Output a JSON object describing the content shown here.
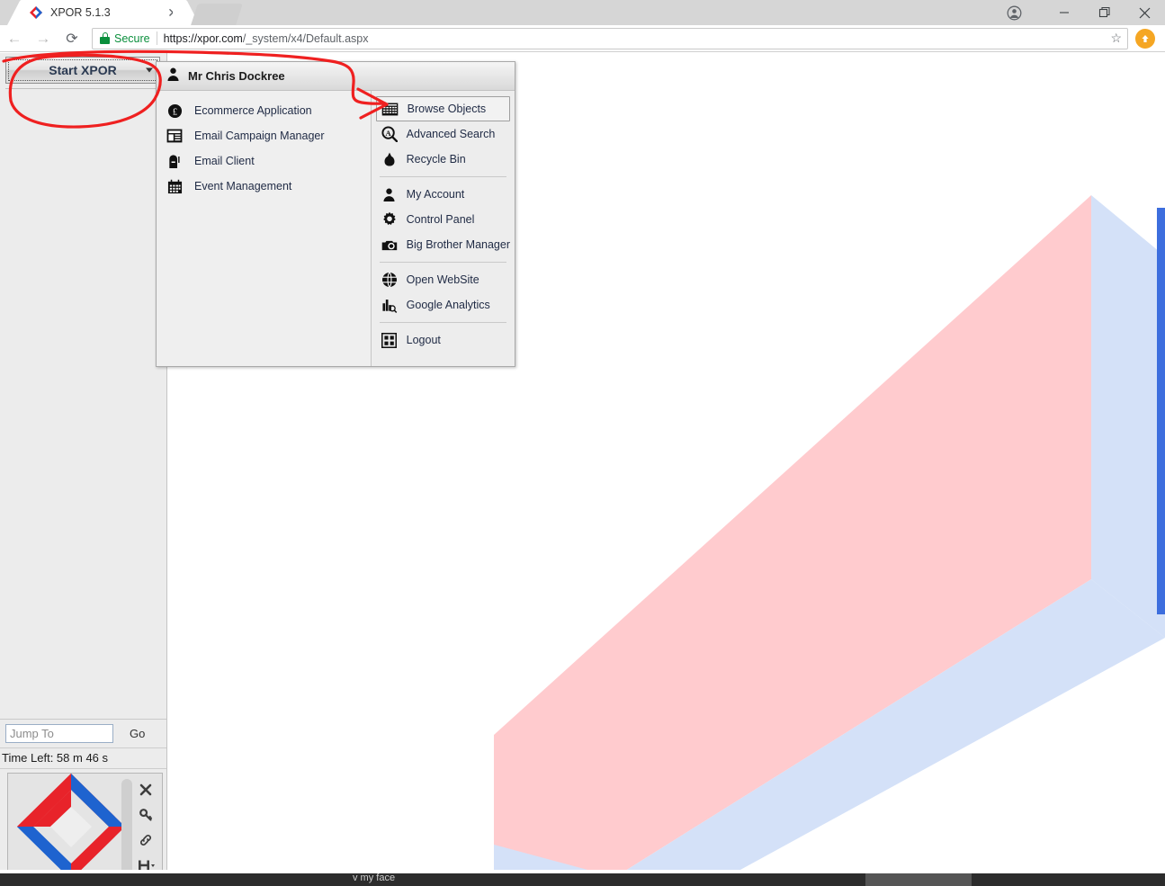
{
  "browser": {
    "tab": {
      "title": "XPOR 5.1.3",
      "favicon": "xpor-diamond-icon",
      "close": "✕"
    },
    "new_tab_tooltip": "New Tab",
    "window_controls": {
      "profile": "profile-icon",
      "minimize": "─",
      "maximize": "❐",
      "close": "✕"
    },
    "nav": {
      "back": "←",
      "forward": "→",
      "reload": "⟳"
    },
    "omnibox": {
      "security_label": "Secure",
      "url_host": "https://xpor.com",
      "url_path": "/_system/x4/Default.aspx",
      "bookmark": "☆"
    },
    "extension": {
      "name": "lastpass-extension-icon"
    }
  },
  "sidebar": {
    "start_button": {
      "label": "Start XPOR",
      "has_dropdown": true
    },
    "jump": {
      "placeholder": "Jump To",
      "value": "",
      "go_label": "Go"
    },
    "time_left": "Time Left: 58 m 46 s",
    "lastpass_widget": {
      "tools": [
        {
          "name": "close-icon",
          "glyph": "✖"
        },
        {
          "name": "key-icon",
          "glyph": "key"
        },
        {
          "name": "link-icon",
          "glyph": "link"
        },
        {
          "name": "save-icon",
          "glyph": "save"
        }
      ]
    }
  },
  "start_menu": {
    "user": "Mr Chris Dockree",
    "user_icon": "person-icon",
    "left_items": [
      {
        "label": "Ecommerce Application",
        "icon": "pound-coin-icon"
      },
      {
        "label": "Email Campaign Manager",
        "icon": "newsletter-icon"
      },
      {
        "label": "Email Client",
        "icon": "mailbox-icon"
      },
      {
        "label": "Event Management",
        "icon": "calendar-icon"
      }
    ],
    "right_groups": [
      {
        "items": [
          {
            "label": "Browse Objects",
            "icon": "grid-table-icon",
            "selected": true
          },
          {
            "label": "Advanced Search",
            "icon": "search-magnifier-icon",
            "selected": false
          },
          {
            "label": "Recycle Bin",
            "icon": "trash-bag-icon",
            "selected": false
          }
        ]
      },
      {
        "items": [
          {
            "label": "My Account",
            "icon": "person-icon",
            "selected": false
          },
          {
            "label": "Control Panel",
            "icon": "gear-icon",
            "selected": false
          },
          {
            "label": "Big Brother Manager",
            "icon": "camera-icon",
            "selected": false
          }
        ]
      },
      {
        "items": [
          {
            "label": "Open WebSite",
            "icon": "globe-icon",
            "selected": false
          },
          {
            "label": "Google Analytics",
            "icon": "bar-chart-magnifier-icon",
            "selected": false
          }
        ]
      },
      {
        "items": [
          {
            "label": "Logout",
            "icon": "windows-grid-icon",
            "selected": false
          }
        ]
      }
    ]
  },
  "annotations": {
    "color": "#ef2020",
    "shapes": [
      {
        "name": "ellipse-around-start-button",
        "type": "ellipse"
      },
      {
        "name": "arrow-to-browse-objects",
        "type": "arrow"
      }
    ]
  },
  "taskbar": {
    "text": "v my face"
  },
  "background_art": {
    "name": "xpor-logo-watermark",
    "pink": "#ffcbce",
    "light_blue": "#d4e1f8",
    "blue": "#3d6ede"
  },
  "theme": {
    "chrome_tabstrip": "#d6d6d6",
    "sidebar_bg": "#ececec",
    "menu_bg": "#efefef",
    "secure_green": "#0a8f3c",
    "extension_orange": "#f5a623",
    "logo_red": "#e8232a",
    "logo_blue": "#1e63cf"
  }
}
